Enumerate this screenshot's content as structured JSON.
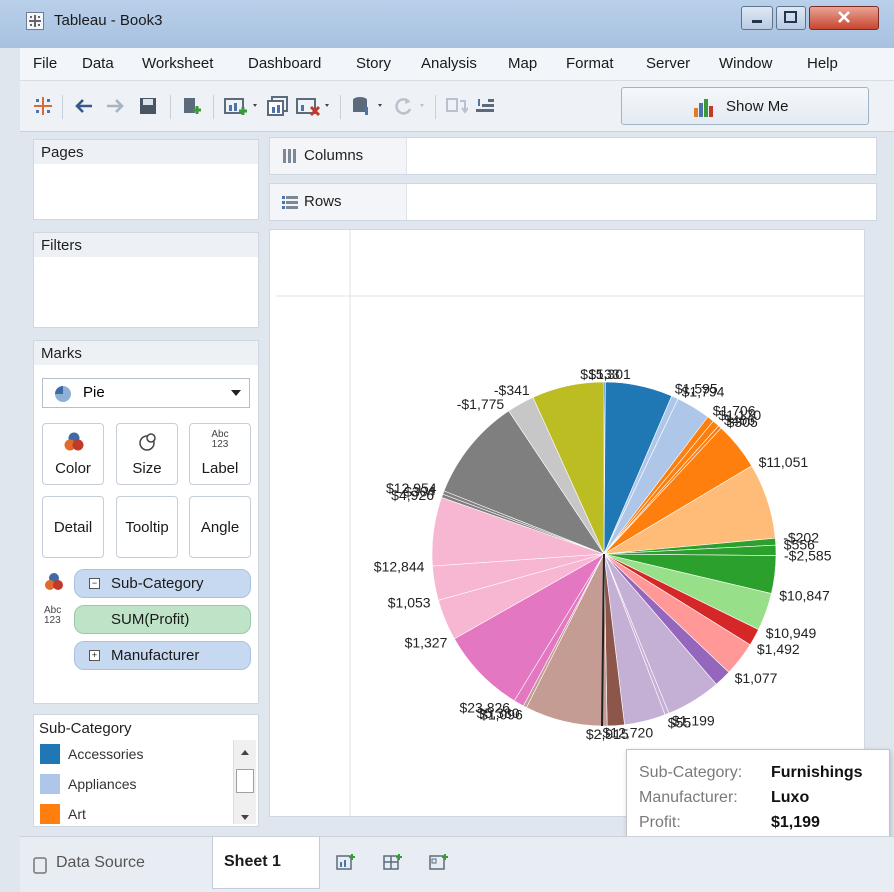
{
  "window": {
    "title": "Tableau - Book3"
  },
  "menu": [
    "File",
    "Data",
    "Worksheet",
    "Dashboard",
    "Story",
    "Analysis",
    "Map",
    "Format",
    "Server",
    "Window",
    "Help"
  ],
  "toolbar": {
    "show_me_label": "Show Me"
  },
  "shelves": {
    "columns_label": "Columns",
    "rows_label": "Rows"
  },
  "panels": {
    "pages": "Pages",
    "filters": "Filters",
    "marks": "Marks"
  },
  "marks": {
    "mark_type": "Pie",
    "cards": {
      "color": "Color",
      "size": "Size",
      "label": "Label",
      "detail": "Detail",
      "tooltip": "Tooltip",
      "angle": "Angle"
    },
    "label_icon_text": [
      "Abc",
      "123"
    ],
    "pills": {
      "color_field": "Sub-Category",
      "label_field": "SUM(Profit)",
      "detail_field": "Manufacturer"
    }
  },
  "legend": {
    "title": "Sub-Category",
    "items": [
      {
        "label": "Accessories",
        "color": "#1f77b4"
      },
      {
        "label": "Appliances",
        "color": "#aec7e8"
      },
      {
        "label": "Art",
        "color": "#ff7f0e"
      }
    ]
  },
  "tooltip": {
    "rows": [
      {
        "key": "Sub-Category:",
        "value": "Furnishings"
      },
      {
        "key": "Manufacturer:",
        "value": "Luxo"
      },
      {
        "key": "Profit:",
        "value": "$1,199"
      }
    ]
  },
  "tabs": {
    "data_source": "Data Source",
    "sheet": "Sheet 1"
  },
  "chart_data": {
    "type": "pie",
    "title": "",
    "slices": [
      {
        "label": "$133",
        "color": "#1f77b4",
        "value": 0.4
      },
      {
        "label": "$15,301",
        "color": "#1f77b4",
        "value": 19.6
      },
      {
        "label": "$1,595",
        "color": "#aec7e8",
        "value": 2
      },
      {
        "label": "$1,794",
        "color": "#aec7e8",
        "value": 10
      },
      {
        "label": "$1,706",
        "color": "#ff7f0e",
        "value": 2
      },
      {
        "label": "$1,170",
        "color": "#ff7f0e",
        "value": 2
      },
      {
        "label": "$406",
        "color": "#ff7f0e",
        "value": 1
      },
      {
        "label": "$305",
        "color": "#ff7f0e",
        "value": 14
      },
      {
        "label": "$11,051",
        "color": "#ffbb78",
        "value": 22
      },
      {
        "label": "-$202",
        "color": "#2ca02c",
        "value": 2
      },
      {
        "label": "$556",
        "color": "#2ca02c",
        "value": 3
      },
      {
        "label": "-$2,585",
        "color": "#2ca02c",
        "value": 11
      },
      {
        "label": "$10,847",
        "color": "#98df8a",
        "value": 11
      },
      {
        "label": "$10,949",
        "color": "#d62728",
        "value": 5
      },
      {
        "label": "$1,492",
        "color": "#ff9896",
        "value": 10
      },
      {
        "label": "$1,077",
        "color": "#9467bd",
        "value": 5
      },
      {
        "label": "",
        "color": "#c5b0d5",
        "value": 16
      },
      {
        "label": "$1,199",
        "color": "#c5b0d5",
        "value": 1.2
      },
      {
        "label": "$55",
        "color": "#c5b0d5",
        "value": 12
      },
      {
        "label": "-$12,720",
        "color": "#8c564b",
        "value": 5
      },
      {
        "label": "$2,915",
        "color": "#c49c94",
        "value": 24
      },
      {
        "label": "$1,096",
        "color": "#c49c94",
        "value": 1
      },
      {
        "label": "$5,380",
        "color": "#e377c2",
        "value": 3
      },
      {
        "label": "$23,826",
        "color": "#e377c2",
        "value": 25
      },
      {
        "label": "$1,327",
        "color": "#f7b6d2",
        "value": 12
      },
      {
        "label": "$1,053",
        "color": "#f7b6d2",
        "value": 10
      },
      {
        "label": "$12,844",
        "color": "#f7b6d2",
        "value": 20
      },
      {
        "label": "$4,926",
        "color": "#7f7f7f",
        "value": 1
      },
      {
        "label": "-$304",
        "color": "#7f7f7f",
        "value": 1
      },
      {
        "label": "$12,954",
        "color": "#7f7f7f",
        "value": 30
      },
      {
        "label": "-$1,775",
        "color": "#c7c7c7",
        "value": 8
      },
      {
        "label": "-$341",
        "color": "#bcbd22",
        "value": 21
      }
    ]
  }
}
